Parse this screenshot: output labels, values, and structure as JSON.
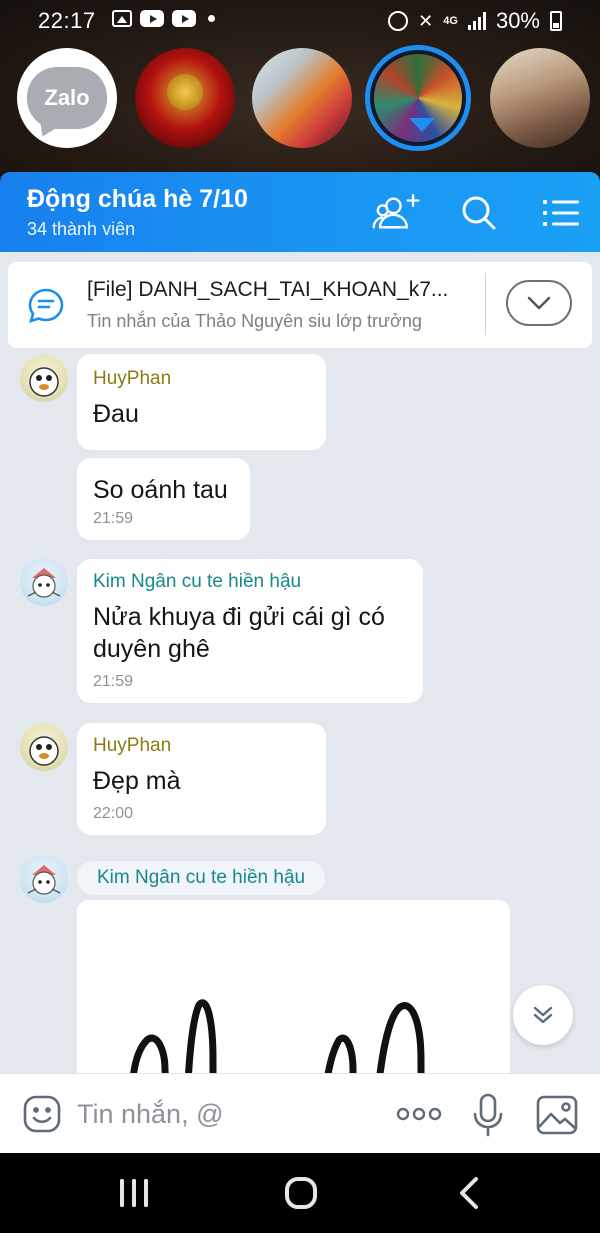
{
  "status_bar": {
    "time": "22:17",
    "network": "4G",
    "battery": "30%"
  },
  "stories": {
    "app_logo_text": "Zalo"
  },
  "header": {
    "title": "Động chúa hè 7/10",
    "members": "34 thành viên",
    "icons": [
      "add-member-icon",
      "search-icon",
      "menu-list-icon"
    ]
  },
  "pinned": {
    "title": "[File] DANH_SACH_TAI_KHOAN_k7...",
    "subtitle": "Tin nhắn của Thảo Nguyên siu lớp trưởng"
  },
  "messages": [
    {
      "sender": "HuyPhan",
      "text": "Đau"
    },
    {
      "text": "So oánh tau",
      "time": "21:59"
    },
    {
      "sender": "Kim Ngân cu te hiền hậu",
      "text": "Nửa khuya đi gửi cái gì có duyên ghê",
      "time": "21:59"
    },
    {
      "sender": "HuyPhan",
      "text": "Đẹp mà",
      "time": "22:00"
    },
    {
      "sender": "Kim Ngân cu te hiền hậu"
    }
  ],
  "composer": {
    "placeholder": "Tin nhắn, @"
  },
  "colors": {
    "header_blue": "#1a90f0",
    "chat_bg": "#e3e8ef",
    "sender_olive": "#8a7b14",
    "sender_teal": "#15888c"
  }
}
